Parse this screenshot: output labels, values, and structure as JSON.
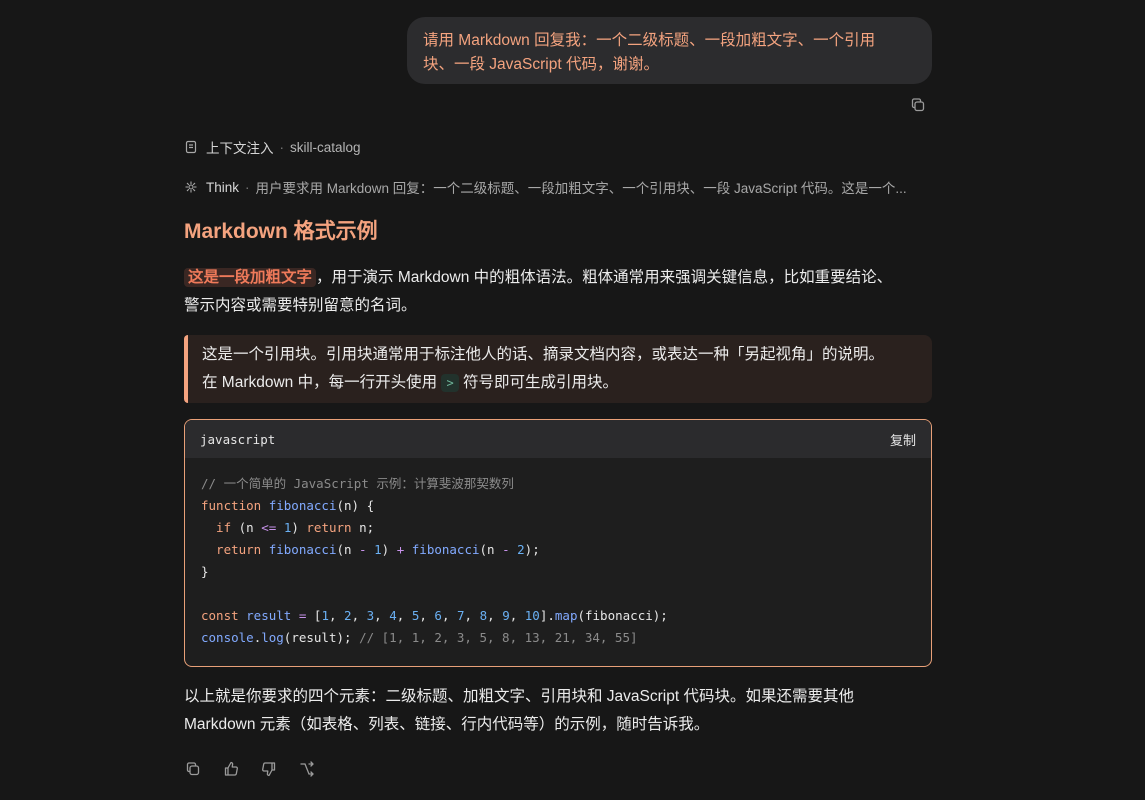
{
  "user_message": {
    "line1": "请用 Markdown 回复我：一个二级标题、一段加粗文字、一个引用",
    "line2": "块、一段 JavaScript 代码，谢谢。"
  },
  "meta": {
    "context_label": "上下文注入",
    "context_detail": "skill-catalog",
    "think_label": "Think",
    "think_text": "用户要求用 Markdown 回复：一个二级标题、一段加粗文字、一个引用块、一段 JavaScript 代码。这是一个..."
  },
  "reply": {
    "heading": "Markdown 格式示例",
    "bold_text": "这是一段加粗文字",
    "para1_line1_rest": "，用于演示 Markdown 中的粗体语法。粗体通常用来强调关键信息，比如重要结论、",
    "para1_line2": "警示内容或需要特别留意的名词。",
    "quote_line1": "这是一个引用块。引用块通常用于标注他人的话、摘录文档内容，或表达一种「另起视角」的说明。",
    "quote_line2_before": "在 Markdown 中，每一行开头使用",
    "quote_inline_code": ">",
    "quote_line2_after": "符号即可生成引用块。",
    "code": {
      "language": "javascript",
      "copy_label": "复制",
      "lines": [
        [
          {
            "t": "// 一个简单的 JavaScript 示例：计算斐波那契数列",
            "c": "cm"
          }
        ],
        [
          {
            "t": "function ",
            "c": "kw"
          },
          {
            "t": "fibonacci",
            "c": "fn"
          },
          {
            "t": "(n) {",
            "c": "pl"
          }
        ],
        [
          {
            "t": "  if ",
            "c": "kw"
          },
          {
            "t": "(n ",
            "c": "pl"
          },
          {
            "t": "<=",
            "c": "op"
          },
          {
            "t": " ",
            "c": "pl"
          },
          {
            "t": "1",
            "c": "nm"
          },
          {
            "t": ") ",
            "c": "pl"
          },
          {
            "t": "return",
            "c": "kw"
          },
          {
            "t": " n;",
            "c": "pl"
          }
        ],
        [
          {
            "t": "  return ",
            "c": "kw"
          },
          {
            "t": "fibonacci",
            "c": "fn"
          },
          {
            "t": "(n ",
            "c": "pl"
          },
          {
            "t": "-",
            "c": "op"
          },
          {
            "t": " ",
            "c": "pl"
          },
          {
            "t": "1",
            "c": "nm"
          },
          {
            "t": ") ",
            "c": "pl"
          },
          {
            "t": "+",
            "c": "op"
          },
          {
            "t": " ",
            "c": "pl"
          },
          {
            "t": "fibonacci",
            "c": "fn"
          },
          {
            "t": "(n ",
            "c": "pl"
          },
          {
            "t": "-",
            "c": "op"
          },
          {
            "t": " ",
            "c": "pl"
          },
          {
            "t": "2",
            "c": "nm"
          },
          {
            "t": ");",
            "c": "pl"
          }
        ],
        [
          {
            "t": "}",
            "c": "pl"
          }
        ],
        [],
        [
          {
            "t": "const ",
            "c": "kw"
          },
          {
            "t": "result ",
            "c": "fn"
          },
          {
            "t": "=",
            "c": "op"
          },
          {
            "t": " [",
            "c": "pl"
          },
          {
            "t": "1",
            "c": "nm"
          },
          {
            "t": ", ",
            "c": "pl"
          },
          {
            "t": "2",
            "c": "nm"
          },
          {
            "t": ", ",
            "c": "pl"
          },
          {
            "t": "3",
            "c": "nm"
          },
          {
            "t": ", ",
            "c": "pl"
          },
          {
            "t": "4",
            "c": "nm"
          },
          {
            "t": ", ",
            "c": "pl"
          },
          {
            "t": "5",
            "c": "nm"
          },
          {
            "t": ", ",
            "c": "pl"
          },
          {
            "t": "6",
            "c": "nm"
          },
          {
            "t": ", ",
            "c": "pl"
          },
          {
            "t": "7",
            "c": "nm"
          },
          {
            "t": ", ",
            "c": "pl"
          },
          {
            "t": "8",
            "c": "nm"
          },
          {
            "t": ", ",
            "c": "pl"
          },
          {
            "t": "9",
            "c": "nm"
          },
          {
            "t": ", ",
            "c": "pl"
          },
          {
            "t": "10",
            "c": "nm"
          },
          {
            "t": "].",
            "c": "pl"
          },
          {
            "t": "map",
            "c": "fn"
          },
          {
            "t": "(fibonacci);",
            "c": "pl"
          }
        ],
        [
          {
            "t": "console",
            "c": "fn"
          },
          {
            "t": ".",
            "c": "pl"
          },
          {
            "t": "log",
            "c": "fn"
          },
          {
            "t": "(result); ",
            "c": "pl"
          },
          {
            "t": "// [1, 1, 2, 3, 5, 8, 13, 21, 34, 55]",
            "c": "cm"
          }
        ]
      ]
    },
    "closing_line1": "以上就是你要求的四个元素：二级标题、加粗文字、引用块和 JavaScript 代码块。如果还需要其他",
    "closing_line2": "Markdown 元素（如表格、列表、链接、行内代码等）的示例，随时告诉我。"
  },
  "icons": {
    "user_copy": "copy-icon",
    "context": "document-icon",
    "think": "sparkle-icon",
    "actions": [
      "copy-icon",
      "thumbs-up-icon",
      "thumbs-down-icon",
      "branch-icon"
    ]
  },
  "colors": {
    "accent": "#f4a37f",
    "background": "#171717",
    "bubble": "#2c2c2e"
  }
}
